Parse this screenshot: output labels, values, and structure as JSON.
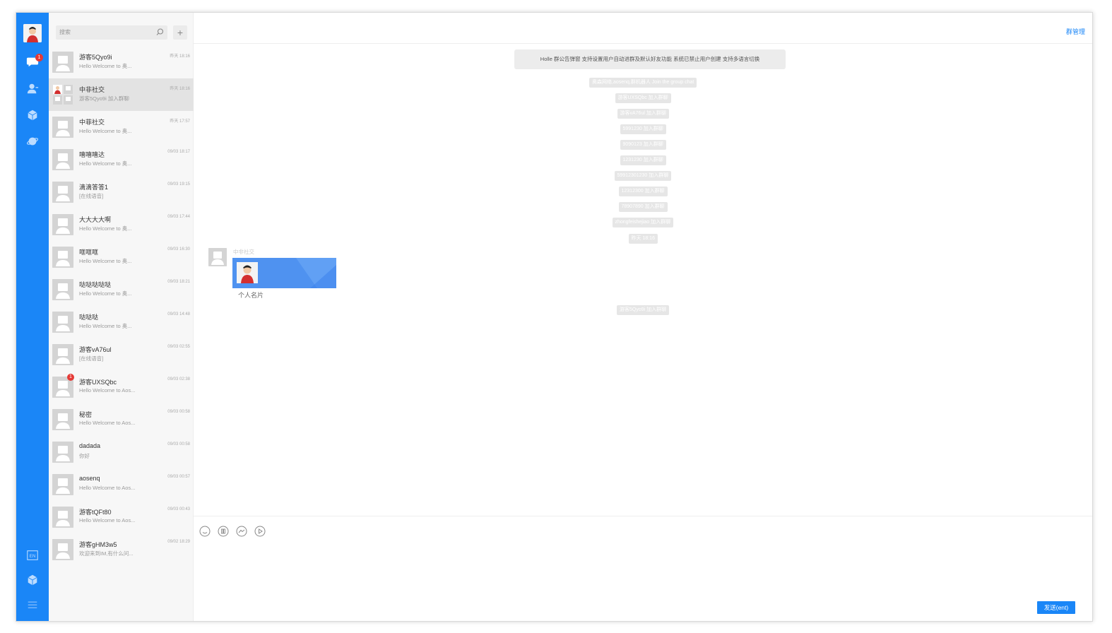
{
  "sidebar": {
    "unread_badge": "1",
    "icons": [
      "chat-icon",
      "contacts-icon",
      "cube-icon",
      "planet-icon",
      "language-icon",
      "cube-icon",
      "menu-icon"
    ],
    "lang_label": "EN"
  },
  "search": {
    "placeholder": "搜索",
    "add_label": "+"
  },
  "conversations": [
    {
      "name": "游客5Qyo9i",
      "preview": "Hello Welcome to 奥...",
      "time": "昨天 18:16",
      "badge": ""
    },
    {
      "name": "中非社交",
      "preview": "游客5Qyo9i 加入群聊",
      "time": "昨天 18:16",
      "badge": ""
    },
    {
      "name": "中菲社交",
      "preview": "Hello Welcome to 奥...",
      "time": "昨天 17:57",
      "badge": ""
    },
    {
      "name": "嘻嘻嘻达",
      "preview": "Hello Welcome to 奥...",
      "time": "09/03 18:17",
      "badge": ""
    },
    {
      "name": "滴滴答答1",
      "preview": "[在线语音]",
      "time": "09/03 19:15",
      "badge": ""
    },
    {
      "name": "大大大大啊",
      "preview": "Hello Welcome to 奥...",
      "time": "09/03 17:44",
      "badge": ""
    },
    {
      "name": "哐哐哐",
      "preview": "Hello Welcome to 奥...",
      "time": "09/03 16:30",
      "badge": ""
    },
    {
      "name": "哒哒哒哒哒",
      "preview": "Hello Welcome to 奥...",
      "time": "09/03 18:21",
      "badge": ""
    },
    {
      "name": "哒哒哒",
      "preview": "Hello Welcome to 奥...",
      "time": "09/03 14:48",
      "badge": ""
    },
    {
      "name": "游客vA76ul",
      "preview": "[在线语音]",
      "time": "09/03 02:55",
      "badge": ""
    },
    {
      "name": "游客UXSQbc",
      "preview": "Hello Welcome to Aos...",
      "time": "09/03 02:38",
      "badge": "1"
    },
    {
      "name": "秘密",
      "preview": "Hello Welcome to Aos...",
      "time": "09/03 00:58",
      "badge": ""
    },
    {
      "name": "dadada",
      "preview": "你好",
      "time": "09/03 00:58",
      "badge": ""
    },
    {
      "name": "aosenq",
      "preview": "Hello Welcome to Aos...",
      "time": "09/03 00:57",
      "badge": ""
    },
    {
      "name": "游客tQFt80",
      "preview": "Hello Welcome to Aos...",
      "time": "09/03 00:43",
      "badge": ""
    },
    {
      "name": "游客gHM3w5",
      "preview": "欢迎来到IM,有什么问...",
      "time": "09/02 18:29",
      "badge": ""
    }
  ],
  "chat": {
    "group_admin_label": "群管理",
    "notice": "Holle 群公告弹窗 支持设置用户自动进群及默认好友功能 系统已禁止用户创建 支持多语言切换",
    "system_messages": [
      "奥森网络,aosenq,群机器人 Join the group chat",
      "游客UXSQbc 加入群聊",
      "游客vA76ul 加入群聊",
      "5991230 加入群聊",
      "9090123 加入群聊",
      "1231230 加入群聊",
      "59912301230 加入群聊",
      "12312300 加入群聊",
      "78907890 加入群聊",
      "zhongfeishejiao 加入群聊",
      "昨天 18:16",
      "游客5Qyo9i 加入群聊"
    ],
    "sender_name": "中非社交",
    "card_label": "个人名片",
    "send_label": "发送(ent)",
    "tools": [
      "emoji-icon",
      "folder-icon",
      "image-icon",
      "video-icon"
    ]
  },
  "colors": {
    "accent": "#1a86f7",
    "badge": "#e53935",
    "card": "#4f92f0"
  }
}
